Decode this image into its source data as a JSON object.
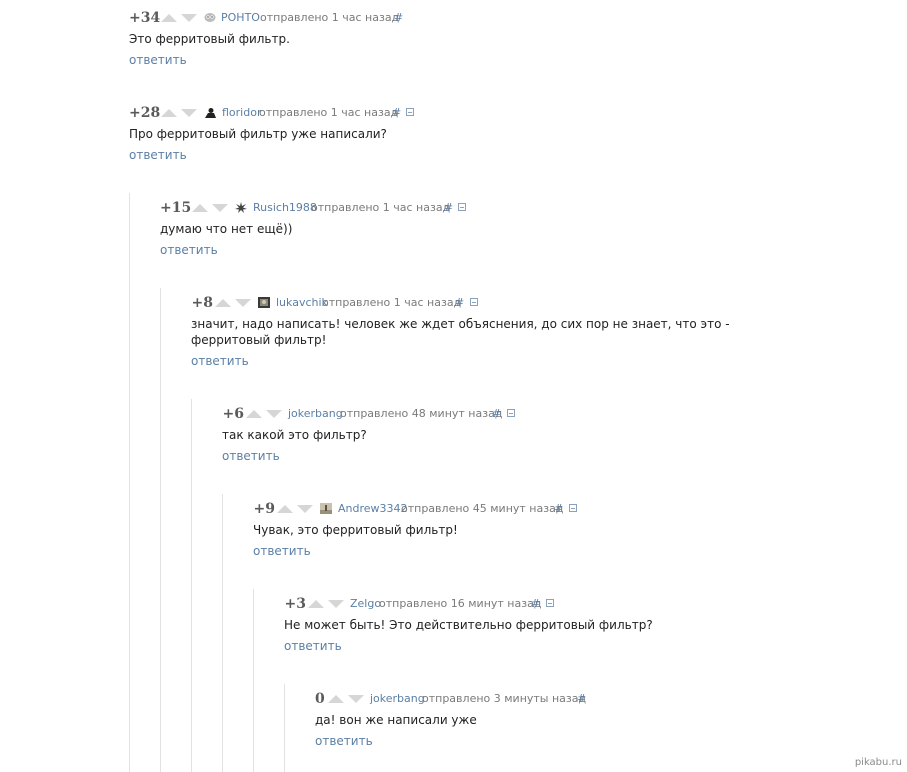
{
  "comments": [
    {
      "rating": "+34",
      "username": "POHTO",
      "posted": "отправлено 1 час назад",
      "hash": "#",
      "text": "Это ферритовый фильтр.",
      "reply": "ответить"
    },
    {
      "rating": "+28",
      "username": "floridor",
      "posted": "отправлено 1 час назад",
      "hash": "#",
      "text": "Про ферритовый фильтр уже написали?",
      "reply": "ответить"
    },
    {
      "rating": "+15",
      "username": "Rusich1988",
      "posted": "отправлено 1 час назад",
      "hash": "#",
      "text": "думаю что нет ещё))",
      "reply": "ответить"
    },
    {
      "rating": "+8",
      "username": "lukavchik",
      "posted": "отправлено 1 час назад",
      "hash": "#",
      "text": "значит, надо написать! человек же ждет объяснения, до сих пор не знает, что это - ферритовый фильтр!",
      "reply": "ответить"
    },
    {
      "rating": "+6",
      "username": "jokerbang",
      "posted": "отправлено 48 минут назад",
      "hash": "#",
      "text": "так какой это фильтр?",
      "reply": "ответить"
    },
    {
      "rating": "+9",
      "username": "Andrew3342",
      "posted": "отправлено 45 минут назад",
      "hash": "#",
      "text": "Чувак, это ферритовый фильтр!",
      "reply": "ответить"
    },
    {
      "rating": "+3",
      "username": "Zelgo",
      "posted": "отправлено 16 минут назад",
      "hash": "#",
      "text": "Не может быть! Это действительно ферритовый фильтр?",
      "reply": "ответить"
    },
    {
      "rating": "0",
      "username": "jokerbang",
      "posted": "отправлено 3 минуты назад",
      "hash": "#",
      "text": "да! вон же написали уже",
      "reply": "ответить"
    }
  ],
  "watermark": "pikabu.ru",
  "colors": {
    "link": "#5b7fa6",
    "meta": "#7a7a7a",
    "rating": "#5a5a5a",
    "vote_arrow": "#d6d6d6",
    "thread_line": "#e2e2e2"
  }
}
